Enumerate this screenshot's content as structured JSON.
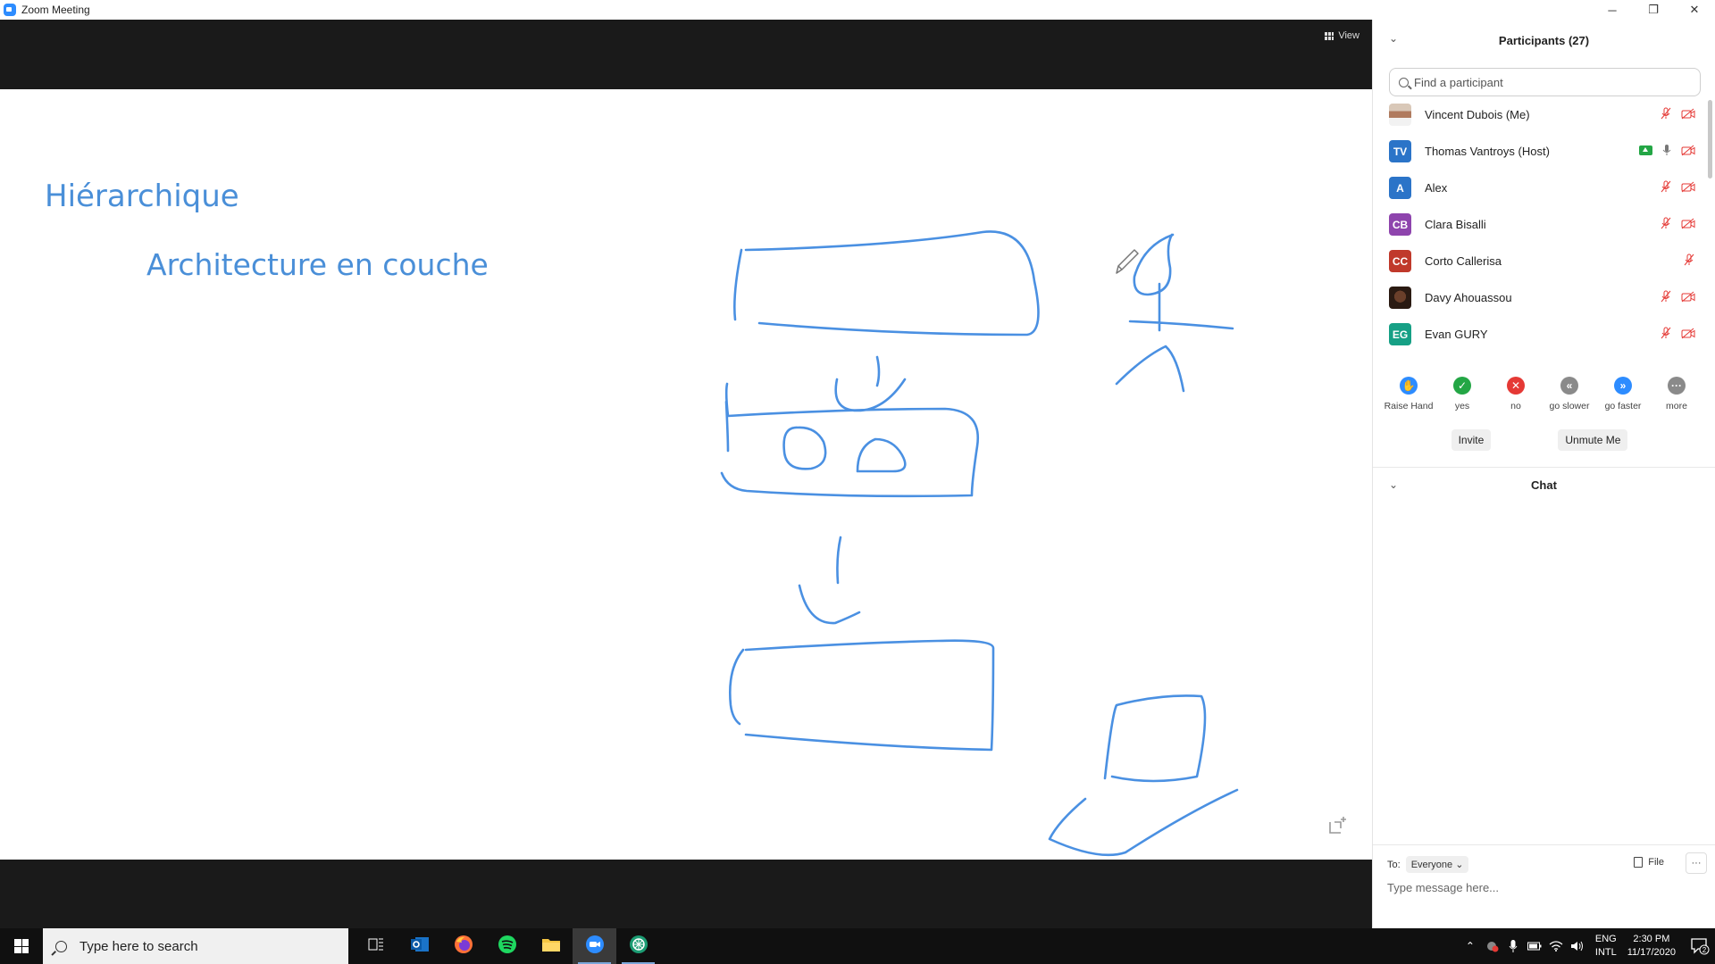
{
  "window": {
    "title": "Zoom Meeting",
    "minimize": "─",
    "maximize": "❐",
    "close": "✕"
  },
  "meeting": {
    "view_label": "View",
    "slide": {
      "title": "Hiérarchique",
      "subtitle": "Architecture en couche"
    }
  },
  "participants": {
    "header": "Participants (27)",
    "search_placeholder": "Find a participant",
    "list": [
      {
        "name": "Vincent Dubois (Me)",
        "initials": "",
        "color": "",
        "photo": "photo1",
        "mic": "muted",
        "video": "off"
      },
      {
        "name": "Thomas Vantroys (Host)",
        "initials": "TV",
        "color": "#2b74c8",
        "photo": "",
        "mic": "on",
        "video": "off",
        "sharing": true
      },
      {
        "name": "Alex",
        "initials": "A",
        "color": "#2b74c8",
        "photo": "",
        "mic": "muted",
        "video": "off"
      },
      {
        "name": "Clara Bisalli",
        "initials": "CB",
        "color": "#8e44ad",
        "photo": "",
        "mic": "muted",
        "video": "off"
      },
      {
        "name": "Corto Callerisa",
        "initials": "CC",
        "color": "#c0392b",
        "photo": "",
        "mic": "muted",
        "video": "none"
      },
      {
        "name": "Davy Ahouassou",
        "initials": "",
        "color": "",
        "photo": "photo2",
        "mic": "muted",
        "video": "off"
      },
      {
        "name": "Evan GURY",
        "initials": "EG",
        "color": "#16a085",
        "photo": "",
        "mic": "muted",
        "video": "off"
      }
    ],
    "reactions": [
      {
        "label": "Raise Hand",
        "icon": "raise-hand-icon",
        "color": "#2d8cff",
        "glyph": "✋"
      },
      {
        "label": "yes",
        "icon": "check-icon",
        "color": "#23a645",
        "glyph": "✓"
      },
      {
        "label": "no",
        "icon": "x-icon",
        "color": "#e53935",
        "glyph": "✕"
      },
      {
        "label": "go slower",
        "icon": "rewind-icon",
        "color": "#8a8a8a",
        "glyph": "«"
      },
      {
        "label": "go faster",
        "icon": "fast-forward-icon",
        "color": "#2d8cff",
        "glyph": "»"
      },
      {
        "label": "more",
        "icon": "more-icon",
        "color": "#8a8a8a",
        "glyph": "···"
      }
    ],
    "invite_label": "Invite",
    "unmute_label": "Unmute Me"
  },
  "chat": {
    "header": "Chat",
    "to_label": "To:",
    "to_value": "Everyone",
    "file_label": "File",
    "more_label": "···",
    "input_placeholder": "Type message here..."
  },
  "taskbar": {
    "search_placeholder": "Type here to search",
    "apps": [
      {
        "name": "task-view-icon",
        "state": ""
      },
      {
        "name": "outlook-icon",
        "state": ""
      },
      {
        "name": "firefox-icon",
        "state": ""
      },
      {
        "name": "spotify-icon",
        "state": ""
      },
      {
        "name": "file-explorer-icon",
        "state": ""
      },
      {
        "name": "zoom-icon",
        "state": "active"
      },
      {
        "name": "app-green-icon",
        "state": "run"
      }
    ],
    "lang_top": "ENG",
    "lang_bottom": "INTL",
    "time": "2:30 PM",
    "date": "11/17/2020",
    "notifications": "2"
  }
}
